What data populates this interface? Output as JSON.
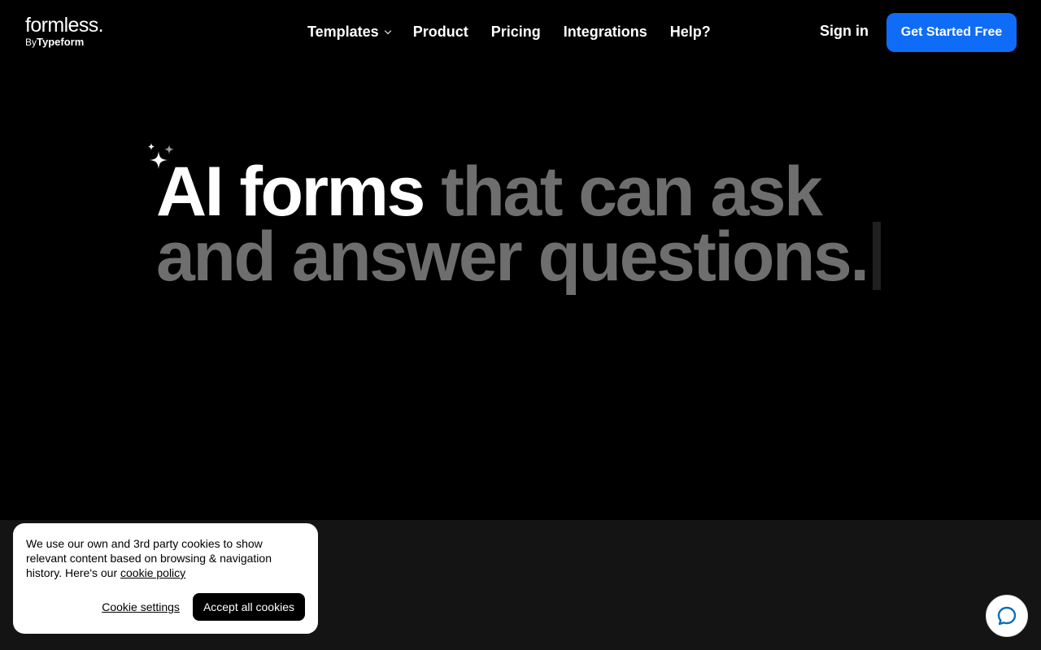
{
  "brand": {
    "name": "formless.",
    "by_prefix": "By",
    "by_company": "Typeform"
  },
  "nav": {
    "items": [
      {
        "label": "Templates",
        "has_dropdown": true
      },
      {
        "label": "Product"
      },
      {
        "label": "Pricing"
      },
      {
        "label": "Integrations"
      },
      {
        "label": "Help?"
      }
    ]
  },
  "header": {
    "signin_label": "Sign in",
    "cta_label": "Get Started Free"
  },
  "hero": {
    "headline_bright": "AI forms",
    "headline_dim": "that can ask and answer questions.",
    "icon": "sparkle-icon"
  },
  "cookie_banner": {
    "text_before": "We use our own and 3rd party cookies to show relevant content based on browsing & navigation history. Here's our",
    "policy_link": "cookie policy",
    "settings_label": "Cookie settings",
    "accept_label": "Accept all cookies"
  },
  "chat": {
    "icon": "chat-bubble-icon"
  },
  "colors": {
    "background": "#000000",
    "cta": "#0f6cf7",
    "dim_text": "#6e6e6e",
    "lower_band": "#141414"
  }
}
